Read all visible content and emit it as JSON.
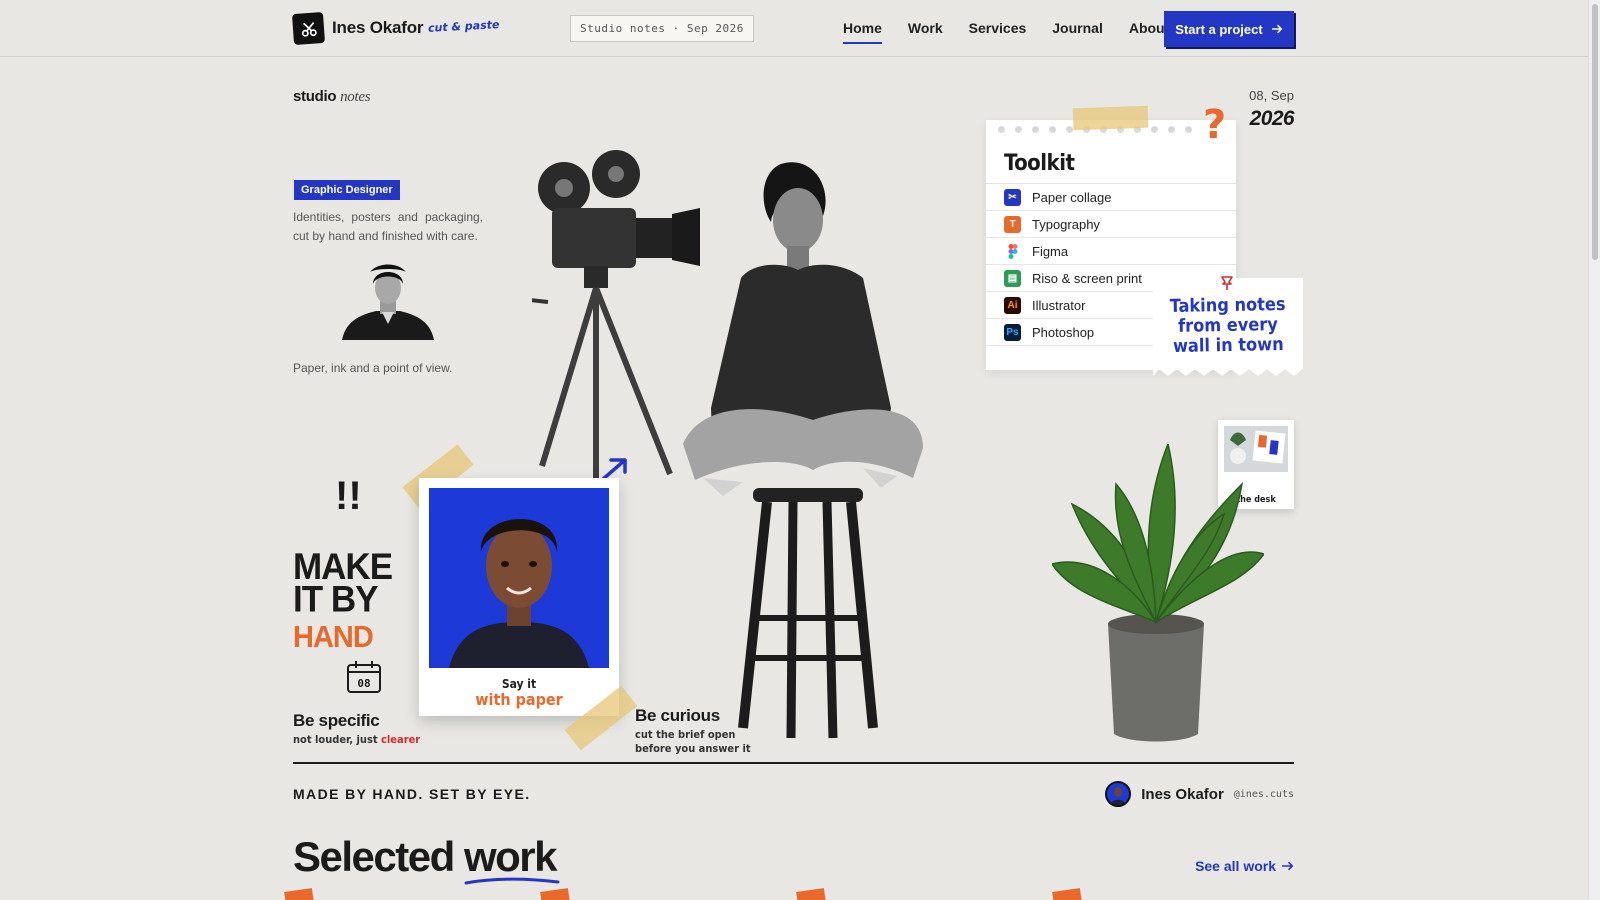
{
  "header": {
    "brand_name": "Ines Okafor",
    "brand_tag": "cut & paste",
    "badge": "Studio notes · Sep 2026",
    "nav": [
      "Home",
      "Work",
      "Services",
      "Journal",
      "About"
    ],
    "cta_label": "Start a project"
  },
  "hero": {
    "section_label": "studio",
    "section_label_italic": "notes",
    "role_badge": "Graphic Designer",
    "intro": "Identities, posters and packaging, cut by hand and finished with care.",
    "caption": "Paper, ink and a point of view.",
    "exclaim": "!!",
    "headline_1": "MAKE",
    "headline_2": "IT BY",
    "headline_3": "HAND",
    "calendar_day": "08",
    "be_specific_title": "Be specific",
    "be_specific_sub": "not louder, just",
    "be_specific_emph": "clearer",
    "polaroid_line1": "Say it",
    "polaroid_line2": "with paper",
    "be_curious_title": "Be curious",
    "be_curious_sub1": "cut the brief open",
    "be_curious_sub2": "before you answer it",
    "date_top": "08, Sep",
    "date_year": "2026"
  },
  "toolkit": {
    "title": "Toolkit",
    "items": [
      {
        "label": "Paper collage",
        "icon": "scissors-icon",
        "color": "#2337c4",
        "glyph": "✂"
      },
      {
        "label": "Typography",
        "icon": "type-icon",
        "color": "#e8692b",
        "glyph": "T"
      },
      {
        "label": "Figma",
        "icon": "figma-icon",
        "color": "#ffffff",
        "glyph": ""
      },
      {
        "label": "Riso & screen print",
        "icon": "printer-icon",
        "color": "#2e9b57",
        "glyph": "▤"
      },
      {
        "label": "Illustrator",
        "icon": "illustrator-icon",
        "color": "#2b0a00",
        "glyph": "Ai"
      },
      {
        "label": "Photoshop",
        "icon": "photoshop-icon",
        "color": "#061e3c",
        "glyph": "Ps"
      }
    ]
  },
  "sticky_note": {
    "line1": "Taking notes",
    "line2": "from every",
    "line3": "wall in town"
  },
  "desk_card": {
    "caption": "the desk"
  },
  "footer_band": {
    "motto": "MADE BY HAND. SET BY EYE.",
    "author_name": "Ines Okafor",
    "author_handle": "@ines.cuts"
  },
  "selected_work": {
    "title_plain": "Selected",
    "title_underlined": "work",
    "see_all": "See all work"
  },
  "colors": {
    "accent_blue": "#2337c4",
    "accent_orange": "#e8692b",
    "background": "#e8e7e3"
  }
}
